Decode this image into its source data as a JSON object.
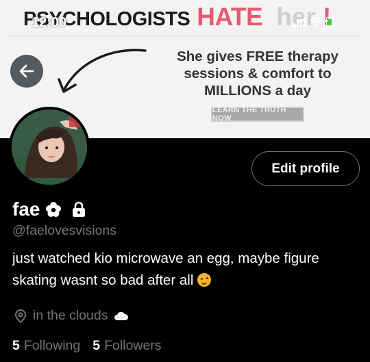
{
  "status_bar": {
    "time": "12:00"
  },
  "banner": {
    "headline_part1": "PSYCHOLOGISTS",
    "headline_part2": "HATE",
    "headline_part3": "her",
    "headline_part4": "!",
    "ad_text": "She gives FREE therapy sessions & comfort to MILLIONS a day",
    "cta": "LEARN THE TRUTH NOW"
  },
  "profile": {
    "display_name": "fae",
    "handle": "@faelovesvisions",
    "bio": "just watched kio microwave an egg, maybe figure skating wasnt so bad after all",
    "location": "in the clouds",
    "following_count": "5",
    "following_label": "Following",
    "followers_count": "5",
    "followers_label": "Followers"
  },
  "actions": {
    "edit_profile": "Edit profile"
  },
  "colors": {
    "accent_pink": "#e45a6e",
    "muted": "#71767b",
    "background": "#000000"
  }
}
